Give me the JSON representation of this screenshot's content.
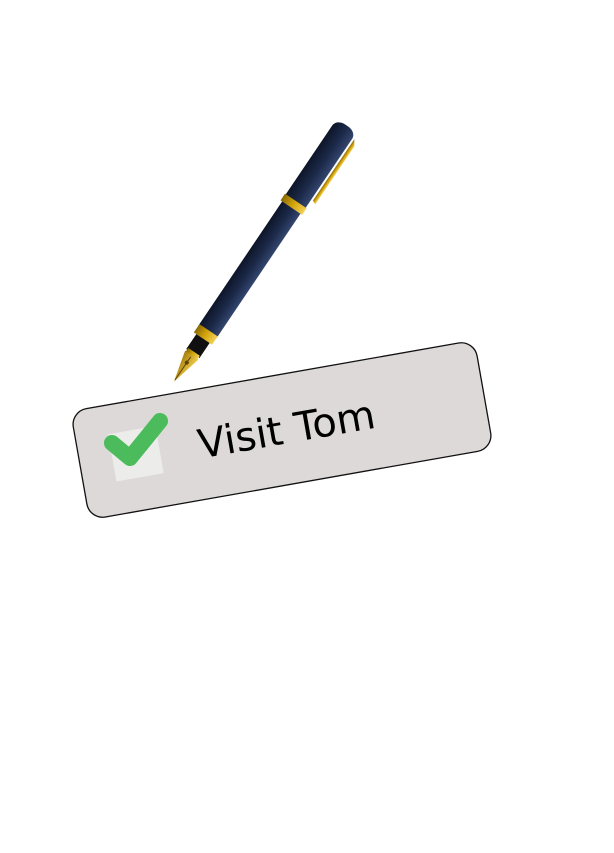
{
  "task": {
    "label": "Visit Tom",
    "checked": true
  },
  "colors": {
    "card_fill": "#dcd9d8",
    "card_stroke": "#111111",
    "checkbox_fill": "#ececea",
    "check_color": "#4cbb5c",
    "pen_body": "#1c2a4a",
    "pen_gold": "#d4a50a",
    "pen_grip": "#101010"
  },
  "icons": {
    "check": "checkmark-icon",
    "pen": "fountain-pen-icon"
  }
}
